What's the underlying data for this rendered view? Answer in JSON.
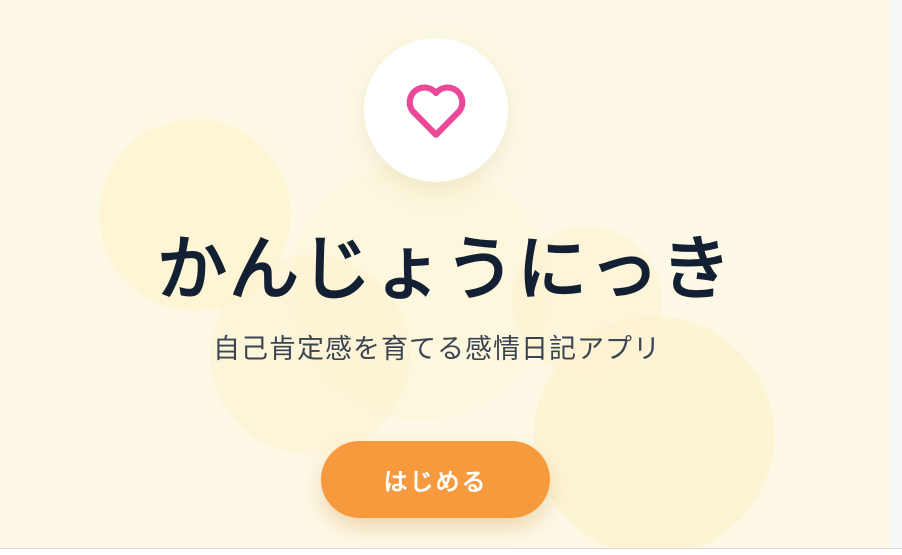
{
  "app": {
    "title": "かんじょうにっき",
    "subtitle": "自己肯定感を育てる感情日記アプリ"
  },
  "logo": {
    "icon": "heart-icon",
    "color": "#ec4899"
  },
  "actions": {
    "start_label": "はじめる"
  },
  "theme": {
    "background": "#fdf9e6",
    "accent": "#f79a3d",
    "text": "#132033"
  }
}
